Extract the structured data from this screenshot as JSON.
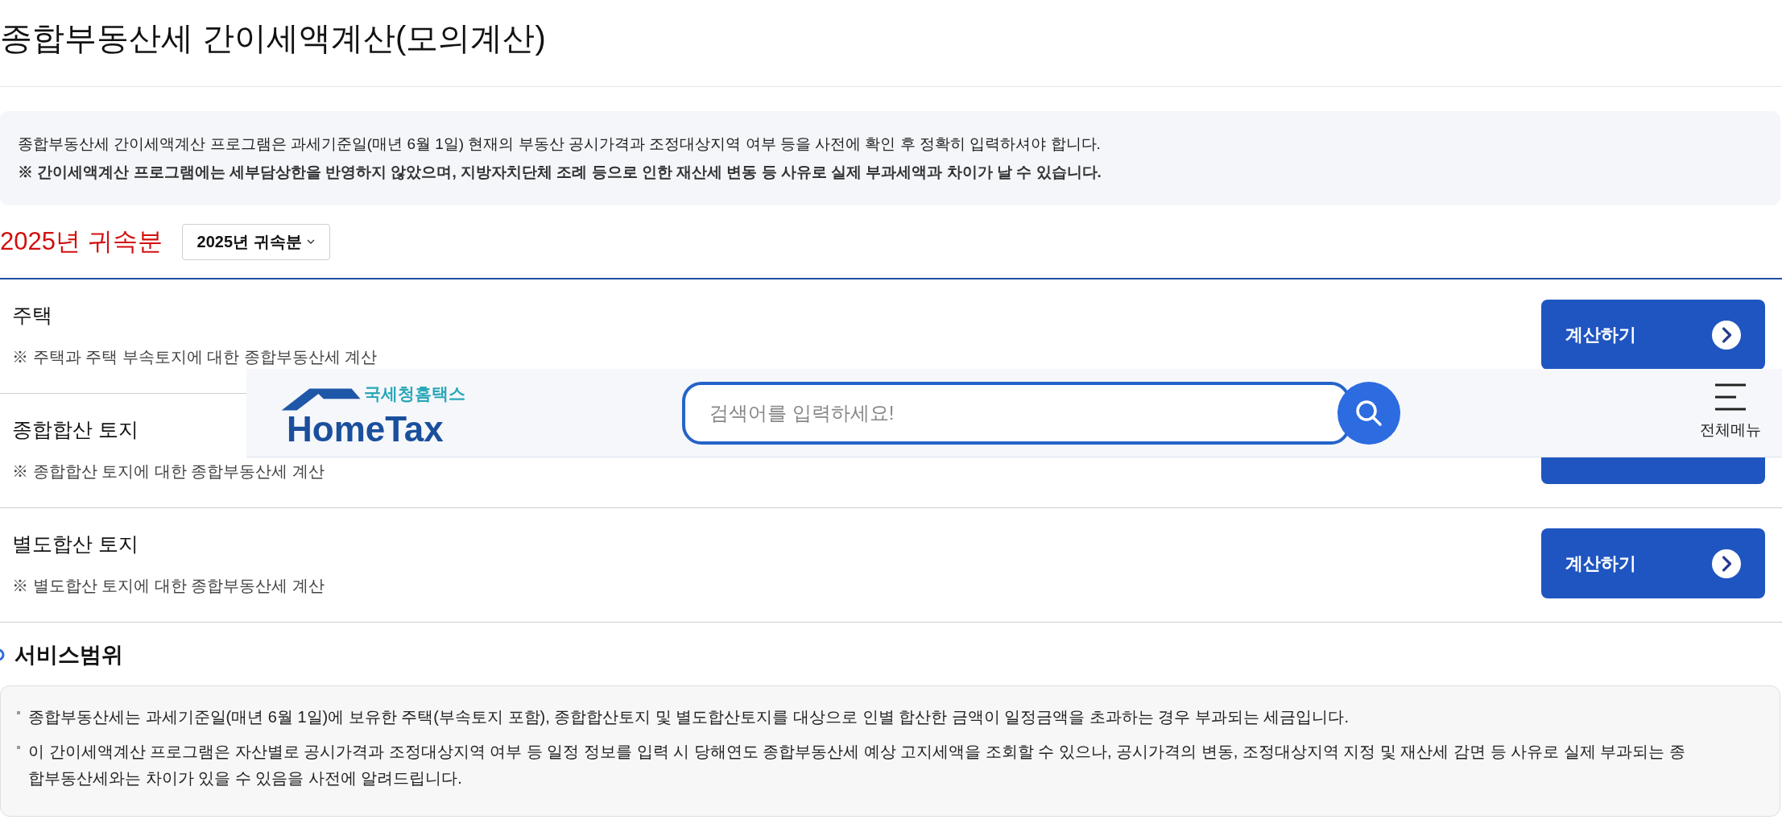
{
  "page_title": "종합부동산세 간이세액계산(모의계산)",
  "notice": [
    "종합부동산세 간이세액계산 프로그램은 과세기준일(매년 6월 1일) 현재의 부동산 공시가격과 조정대상지역 여부 등을 사전에 확인 후 정확히 입력하셔야 합니다.",
    "※ 간이세액계산 프로그램에는 세부담상한을 반영하지 않았으며, 지방자치단체 조례 등으로 인한 재산세 변동 등 사유로 실제 부과세액과 차이가 날 수 있습니다."
  ],
  "year": {
    "heading": "2025년 귀속분",
    "select_value": "2025년 귀속분"
  },
  "rows": [
    {
      "title": "주택",
      "description": "※ 주택과 주택 부속토지에 대한 종합부동산세 계산",
      "button": {
        "label": "계산하기"
      }
    },
    {
      "title": "종합합산 토지",
      "description": "※ 종합합산 토지에 대한 종합부동산세 계산",
      "button": {}
    },
    {
      "title": "별도합산 토지",
      "description": "※ 별도합산 토지에 대한 종합부동산세 계산",
      "button": {
        "label": "계산하기"
      }
    }
  ],
  "header": {
    "logo_small": "국세청홈택스",
    "logo_large": "HomeTax",
    "search_placeholder": "검색어를 입력하세요!",
    "menu_label": "전체메뉴"
  },
  "service": {
    "heading": "서비스범위",
    "items": [
      "종합부동산세는 과세기준일(매년 6월 1일)에 보유한 주택(부속토지 포함), 종합합산토지 및 별도합산토지를 대상으로 인별 합산한 금액이 일정금액을 초과하는 경우 부과되는 세금입니다.",
      "이 간이세액계산 프로그램은 자산별로 공시가격과 조정대상지역 여부 등 일정 정보를 입력 시 당해연도 종합부동산세 예상 고지세액을 조회할 수 있으나, 공시가격의 변동, 조정대상지역 지정 및 재산세 감면 등 사유로 실제 부과되는 종합부동산세와는 차이가 있을 수 있음을 사전에 알려드립니다."
    ]
  }
}
